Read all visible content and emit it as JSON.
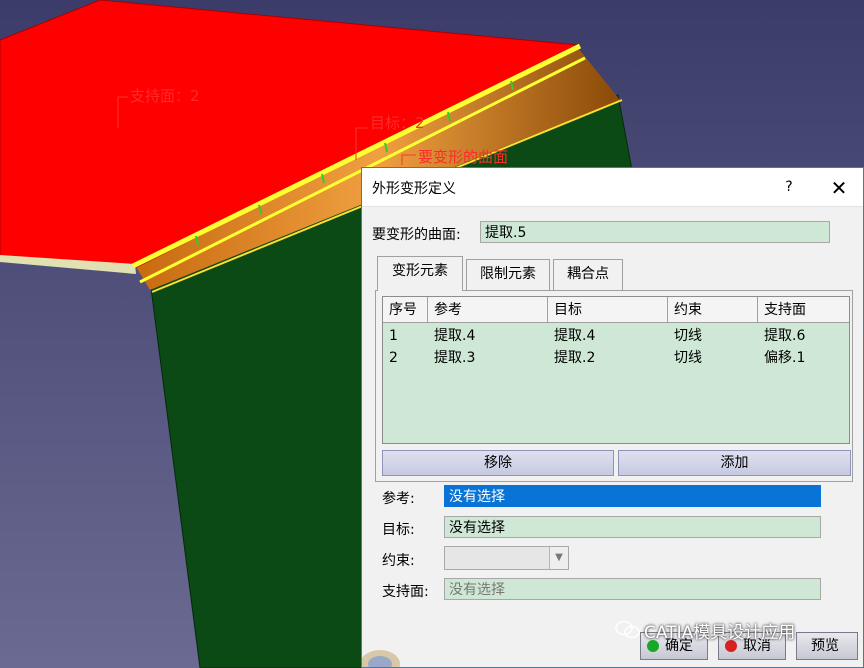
{
  "viewport": {
    "labels": {
      "support": "支持面：2",
      "target": "目标：2",
      "surface": "要变形的曲面"
    }
  },
  "dialog": {
    "title": "外形变形定义",
    "help_label": "?",
    "close_label": "✕",
    "surface_label": "要变形的曲面:",
    "surface_value": "提取.5",
    "tabs": [
      {
        "label": "变形元素",
        "active": true
      },
      {
        "label": "限制元素",
        "active": false
      },
      {
        "label": "耦合点",
        "active": false
      }
    ],
    "table": {
      "columns": [
        "序号",
        "参考",
        "目标",
        "约束",
        "支持面"
      ],
      "rows": [
        [
          "1",
          "提取.4",
          "提取.4",
          "切线",
          "提取.6"
        ],
        [
          "2",
          "提取.3",
          "提取.2",
          "切线",
          "偏移.1"
        ]
      ]
    },
    "remove_label": "移除",
    "add_label": "添加",
    "reference_label": "参考:",
    "reference_value": "没有选择",
    "target_label": "目标:",
    "target_value": "没有选择",
    "constraint_label": "约束:",
    "support_label": "支持面:",
    "support_value": "没有选择",
    "ok_label": "确定",
    "cancel_label": "取消",
    "preview_label": "预览"
  },
  "watermark": "CATIA模具设计应用",
  "colors": {
    "background": "#4a4a7a",
    "top_surface": "#ff0000",
    "side_surface": "#0a4a12",
    "fillet": "#e08a1a",
    "edge_highlight": "#ffff33",
    "field_green": "#cfe8d6",
    "selection_blue": "#0a74d6",
    "title_accent": "#2c7fd0"
  }
}
